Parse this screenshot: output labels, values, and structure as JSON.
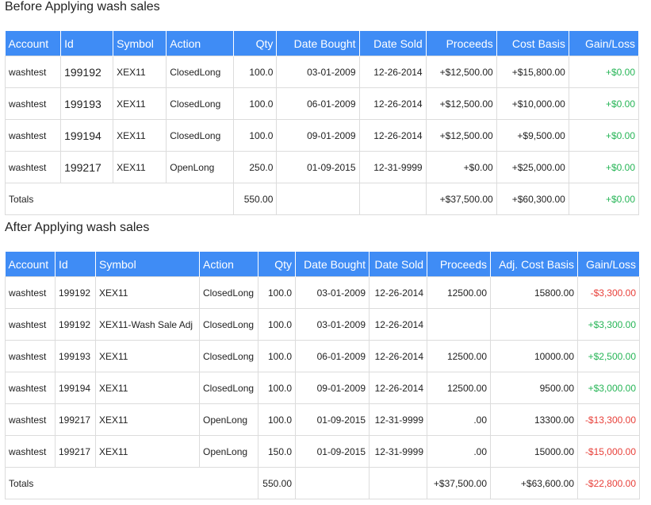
{
  "before": {
    "title": "Before Applying wash sales",
    "headers": [
      "Account",
      "Id",
      "Symbol",
      "Action",
      "Qty",
      "Date Bought",
      "Date Sold",
      "Proceeds",
      "Cost Basis",
      "Gain/Loss"
    ],
    "rows": [
      {
        "account": "washtest",
        "id": "199192",
        "symbol": "XEX11",
        "action": "ClosedLong",
        "qty": "100.0",
        "bought": "03-01-2009",
        "sold": "12-26-2014",
        "proceeds": "+$12,500.00",
        "basis": "+$15,800.00",
        "gain": "+$0.00"
      },
      {
        "account": "washtest",
        "id": "199193",
        "symbol": "XEX11",
        "action": "ClosedLong",
        "qty": "100.0",
        "bought": "06-01-2009",
        "sold": "12-26-2014",
        "proceeds": "+$12,500.00",
        "basis": "+$10,000.00",
        "gain": "+$0.00"
      },
      {
        "account": "washtest",
        "id": "199194",
        "symbol": "XEX11",
        "action": "ClosedLong",
        "qty": "100.0",
        "bought": "09-01-2009",
        "sold": "12-26-2014",
        "proceeds": "+$12,500.00",
        "basis": "+$9,500.00",
        "gain": "+$0.00"
      },
      {
        "account": "washtest",
        "id": "199217",
        "symbol": "XEX11",
        "action": "OpenLong",
        "qty": "250.0",
        "bought": "01-09-2015",
        "sold": "12-31-9999",
        "proceeds": "+$0.00",
        "basis": "+$25,000.00",
        "gain": "+$0.00"
      }
    ],
    "totals": {
      "label": "Totals",
      "qty": "550.00",
      "proceeds": "+$37,500.00",
      "basis": "+$60,300.00",
      "gain": "+$0.00"
    }
  },
  "after": {
    "title": "After Applying wash sales",
    "headers": [
      "Account",
      "Id",
      "Symbol",
      "Action",
      "Qty",
      "Date Bought",
      "Date Sold",
      "Proceeds",
      "Adj. Cost Basis",
      "Gain/Loss"
    ],
    "rows": [
      {
        "account": "washtest",
        "id": "199192",
        "symbol": "XEX11",
        "action": "ClosedLong",
        "qty": "100.0",
        "bought": "03-01-2009",
        "sold": "12-26-2014",
        "proceeds": "12500.00",
        "basis": "15800.00",
        "gain": "-$3,300.00"
      },
      {
        "account": "washtest",
        "id": "199192",
        "symbol": "XEX11-Wash Sale Adj",
        "action": "ClosedLong",
        "qty": "100.0",
        "bought": "03-01-2009",
        "sold": "12-26-2014",
        "proceeds": "",
        "basis": "",
        "gain": "+$3,300.00"
      },
      {
        "account": "washtest",
        "id": "199193",
        "symbol": "XEX11",
        "action": "ClosedLong",
        "qty": "100.0",
        "bought": "06-01-2009",
        "sold": "12-26-2014",
        "proceeds": "12500.00",
        "basis": "10000.00",
        "gain": "+$2,500.00"
      },
      {
        "account": "washtest",
        "id": "199194",
        "symbol": "XEX11",
        "action": "ClosedLong",
        "qty": "100.0",
        "bought": "09-01-2009",
        "sold": "12-26-2014",
        "proceeds": "12500.00",
        "basis": "9500.00",
        "gain": "+$3,000.00"
      },
      {
        "account": "washtest",
        "id": "199217",
        "symbol": "XEX11",
        "action": "OpenLong",
        "qty": "100.0",
        "bought": "01-09-2015",
        "sold": "12-31-9999",
        "proceeds": ".00",
        "basis": "13300.00",
        "gain": "-$13,300.00"
      },
      {
        "account": "washtest",
        "id": "199217",
        "symbol": "XEX11",
        "action": "OpenLong",
        "qty": "150.0",
        "bought": "01-09-2015",
        "sold": "12-31-9999",
        "proceeds": ".00",
        "basis": "15000.00",
        "gain": "-$15,000.00"
      }
    ],
    "totals": {
      "label": "Totals",
      "qty": "550.00",
      "proceeds": "+$37,500.00",
      "basis": "+$63,600.00",
      "gain": "-$22,800.00"
    }
  },
  "colors": {
    "header_bg": "#3f8cf5",
    "positive": "#26b556",
    "negative": "#e8403a"
  }
}
